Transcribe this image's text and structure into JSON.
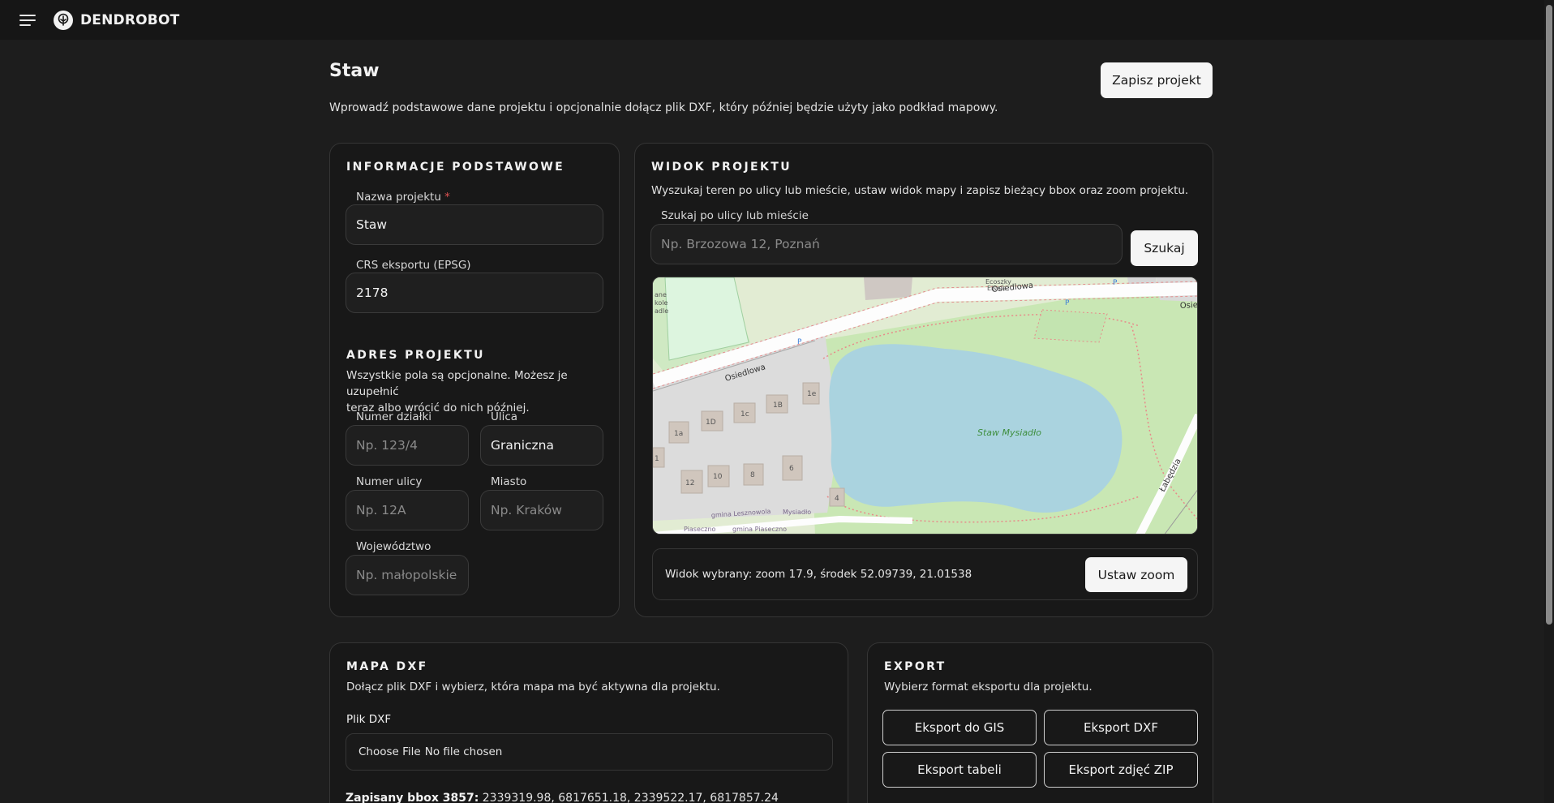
{
  "app": {
    "brand": "DENDROBOT"
  },
  "header": {
    "title": "Staw",
    "description": "Wprowadź podstawowe dane projektu i opcjonalnie dołącz plik DXF, który później będzie użyty jako podkład mapowy.",
    "save_label": "Zapisz projekt"
  },
  "info": {
    "title": "INFORMACJE PODSTAWOWE",
    "name_label": "Nazwa projektu",
    "name_required": "*",
    "name_value": "Staw",
    "crs_label": "CRS eksportu (EPSG)",
    "crs_value": "2178"
  },
  "address": {
    "title": "ADRES PROJEKTU",
    "subtitle_line1": "Wszystkie pola są opcjonalne. Możesz je uzupełnić",
    "subtitle_line2": "teraz albo wrócić do nich później.",
    "parcel_label": "Numer działki",
    "parcel_placeholder": "Np. 123/4",
    "street_label": "Ulica",
    "street_value": "Graniczna",
    "street_no_label": "Numer ulicy",
    "street_no_placeholder": "Np. 12A",
    "city_label": "Miasto",
    "city_placeholder": "Np. Kraków",
    "voivodeship_label": "Województwo",
    "voivodeship_placeholder": "Np. małopolskie"
  },
  "view": {
    "title": "WIDOK PROJEKTU",
    "subtitle": "Wyszukaj teren po ulicy lub mieście, ustaw widok mapy i zapisz bieżący bbox oraz zoom projektu.",
    "search_label": "Szukaj po ulicy lub mieście",
    "search_placeholder": "Np. Brzozowa 12, Poznań",
    "search_button": "Szukaj",
    "status": "Widok wybrany: zoom 17.9, środek 52.09739, 21.01538",
    "zoom_button": "Ustaw zoom",
    "map_labels": {
      "street_main": "Osiedlowa",
      "street_main_right": "Osiedlowa",
      "street_cut": "Osie",
      "pond": "Staw Mysiadło",
      "street_right": "Łabędzia",
      "gmina1": "gmina Lesznowola",
      "gmina_mysiadlo": "Mysiadło",
      "gmina2": "Piaseczno",
      "gmina3": "gmina Piaseczno",
      "corner_top": "Ecoszky",
      "corner_top2": "Eisele",
      "left_a": "ane",
      "left_b": "kole",
      "left_c": "adle",
      "parking": "P",
      "houses": [
        "1a",
        "1D",
        "1c",
        "1B",
        "1e",
        "12",
        "10",
        "8",
        "6",
        "4",
        "1"
      ]
    }
  },
  "dxf": {
    "title": "MAPA DXF",
    "subtitle": "Dołącz plik DXF i wybierz, która mapa ma być aktywna dla projektu.",
    "file_label": "Plik DXF",
    "file_button": "Choose File",
    "file_status": "No file chosen",
    "bbox_label": "Zapisany bbox 3857:",
    "bbox_value": "2339319.98, 6817651.18, 2339522.17, 6817857.24"
  },
  "export": {
    "title": "EXPORT",
    "subtitle": "Wybierz format eksportu dla projektu.",
    "gis": "Eksport do GIS",
    "dxf": "Eksport DXF",
    "table": "Eksport tabeli",
    "photos": "Eksport zdjęć ZIP"
  }
}
